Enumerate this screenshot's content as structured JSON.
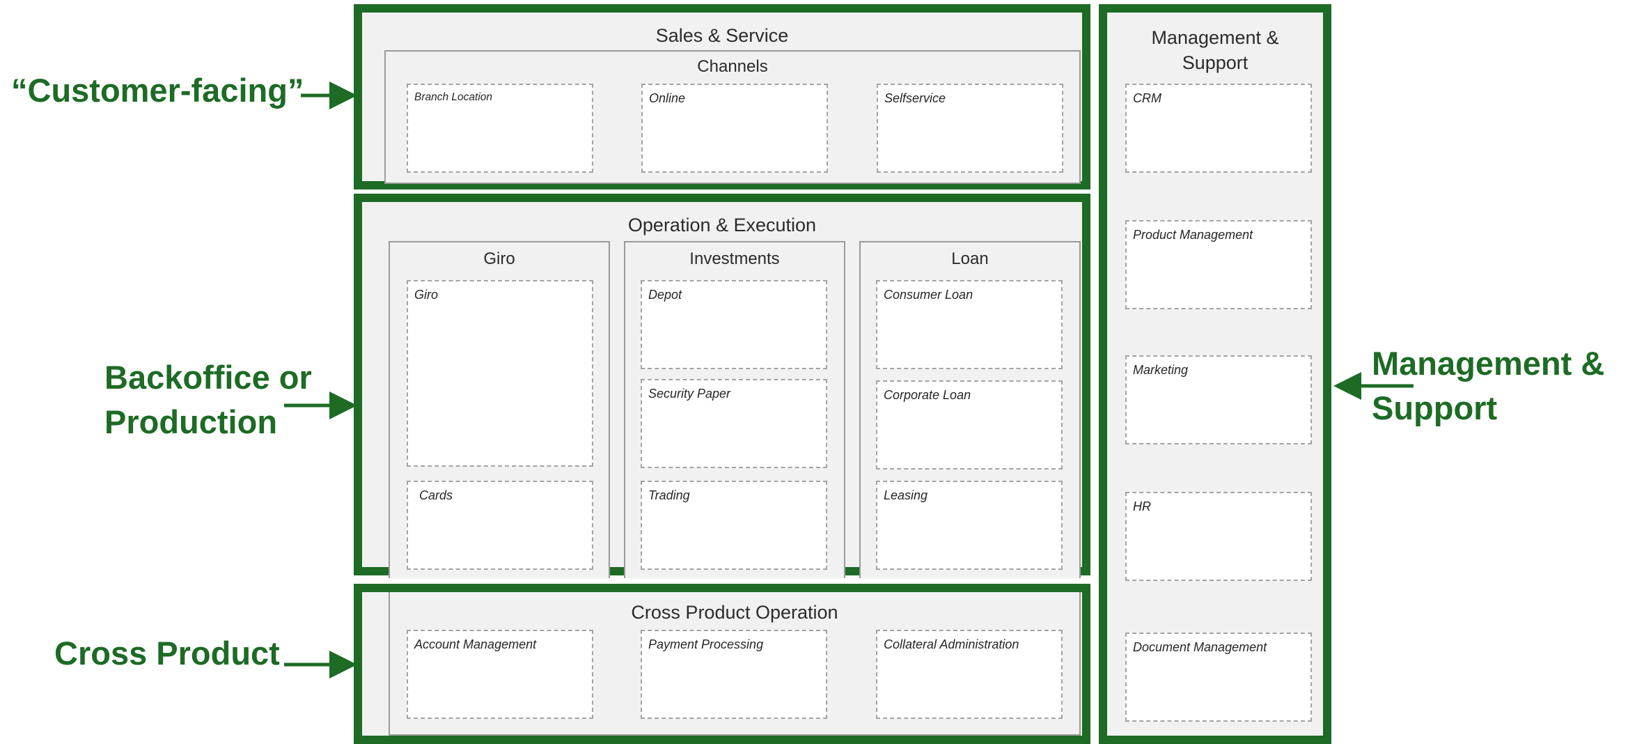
{
  "side_labels": {
    "customer_facing": "“Customer-facing”",
    "backoffice_line1": "Backoffice or",
    "backoffice_line2": "Production",
    "cross_product": "Cross Product",
    "management_line1": "Management &",
    "management_line2": "Support"
  },
  "sales_service": {
    "title": "Sales & Service",
    "channels": {
      "title": "Channels",
      "items": [
        "Branch Location",
        "Online",
        "Selfservice"
      ]
    }
  },
  "operation_execution": {
    "title": "Operation & Execution",
    "groups": [
      {
        "title": "Giro",
        "items": [
          "Giro",
          "Cards"
        ]
      },
      {
        "title": "Investments",
        "items": [
          "Depot",
          "Security Paper",
          "Trading"
        ]
      },
      {
        "title": "Loan",
        "items": [
          "Consumer Loan",
          "Corporate Loan",
          "Leasing"
        ]
      }
    ]
  },
  "cross_product_operation": {
    "title": "Cross Product Operation",
    "items": [
      "Account Management",
      "Payment Processing",
      "Collateral Administration"
    ]
  },
  "management_support": {
    "title_line1": "Management &",
    "title_line2": "Support",
    "items": [
      "CRM",
      "Product Management",
      "Marketing",
      "HR",
      "Document Management"
    ]
  },
  "colors": {
    "accent_green": "#1d6b25",
    "panel_gray": "#f1f1f1",
    "dashed_border": "#a3a3a3"
  }
}
